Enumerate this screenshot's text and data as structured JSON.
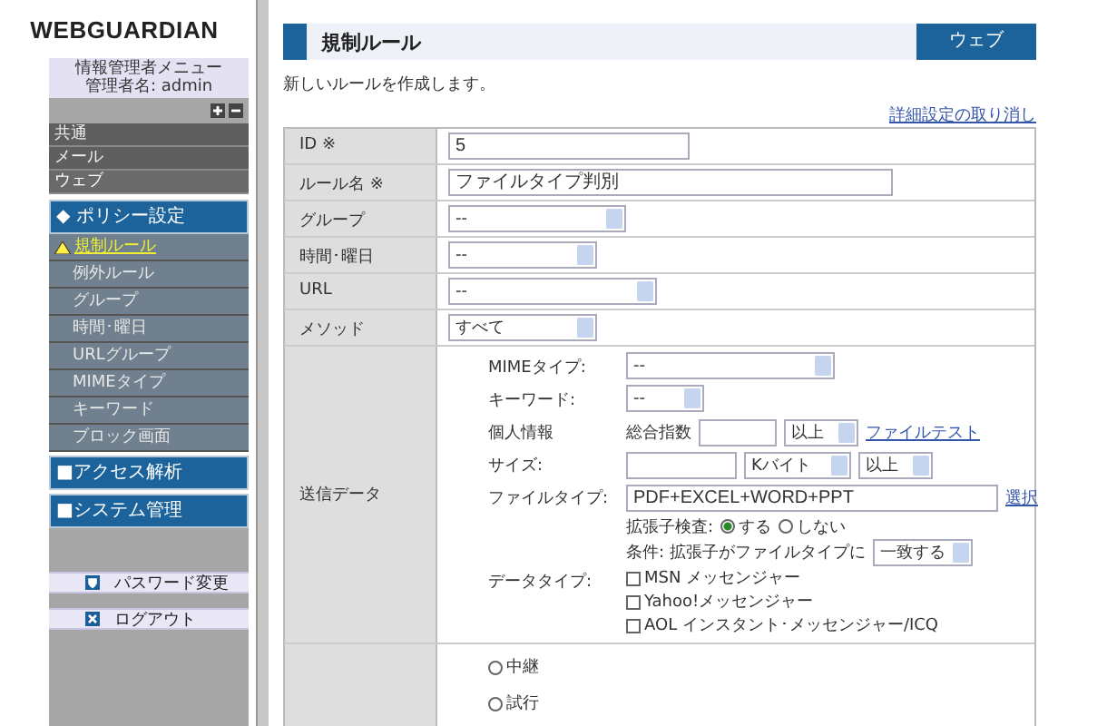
{
  "sidebar": {
    "logo": "WEBGUARDIAN",
    "admin_title": "情報管理者メニュー",
    "admin_name": "管理者名: admin",
    "categories": [
      {
        "label": "共通",
        "selected": false
      },
      {
        "label": "メール",
        "selected": false
      },
      {
        "label": "ウェブ",
        "selected": true
      }
    ],
    "sections_top": [
      {
        "label": "◆ ポリシー設定"
      }
    ],
    "submenu": [
      {
        "label": "規制ルール",
        "selected": true
      },
      {
        "label": "例外ルール",
        "selected": false
      },
      {
        "label": "グループ",
        "selected": false
      },
      {
        "label": "時間･曜日",
        "selected": false
      },
      {
        "label": "URLグループ",
        "selected": false
      },
      {
        "label": "MIMEタイプ",
        "selected": false
      },
      {
        "label": "キーワード",
        "selected": false
      },
      {
        "label": "ブロック画面",
        "selected": false
      }
    ],
    "sections_bottom": [
      {
        "label": "■アクセス解析"
      },
      {
        "label": "■システム管理"
      }
    ],
    "actions": [
      {
        "kind": "password",
        "label": "パスワード変更"
      },
      {
        "kind": "logout",
        "label": "ログアウト"
      }
    ]
  },
  "header": {
    "title": "規制ルール",
    "category": "ウェブ"
  },
  "intro": "新しいルールを作成します。",
  "cancel_link": "詳細設定の取り消し",
  "rows": [
    {
      "label": "ID ※",
      "kind": "text",
      "value": "5"
    },
    {
      "label": "ルール名 ※",
      "kind": "text",
      "value": "ファイルタイプ判別"
    },
    {
      "label": "グループ",
      "kind": "select",
      "value": "--"
    },
    {
      "label": "時間･曜日",
      "kind": "select",
      "value": "--"
    },
    {
      "label": "URL",
      "kind": "select",
      "value": "--"
    },
    {
      "label": "メソッド",
      "kind": "select",
      "value": "すべて"
    }
  ],
  "send_data": {
    "label": "送信データ",
    "items": [
      {
        "kind": "select",
        "label": "MIMEタイプ:",
        "value": "--"
      },
      {
        "kind": "select",
        "label": "キーワード:",
        "value": "--"
      },
      {
        "kind": "personal",
        "label": "個人情報",
        "prefix": "総合指数",
        "compare": "以上",
        "link": "ファイルテスト"
      },
      {
        "kind": "size",
        "label": "サイズ:",
        "unit": "Kバイト",
        "compare": "以上"
      },
      {
        "kind": "filetype",
        "label": "ファイルタイプ:",
        "value": "PDF+EXCEL+WORD+PPT",
        "link": "選択",
        "check_label": "拡張子検査:",
        "options": [
          {
            "label": "する",
            "selected": true
          },
          {
            "label": "しない",
            "selected": false
          }
        ],
        "condition_label": "条件: 拡張子がファイルタイプに",
        "condition": "一致する"
      },
      {
        "kind": "checks",
        "label": "データタイプ:",
        "options": [
          {
            "label": "MSN メッセンジャー",
            "checked": false
          },
          {
            "label": "Yahoo!メッセンジャー",
            "checked": false
          },
          {
            "label": "AOL インスタント･メッセンジャー/ICQ",
            "checked": false
          }
        ]
      }
    ]
  },
  "action_row": {
    "options": [
      {
        "label": "中継",
        "selected": false
      },
      {
        "label": "試行",
        "selected": false
      }
    ]
  }
}
